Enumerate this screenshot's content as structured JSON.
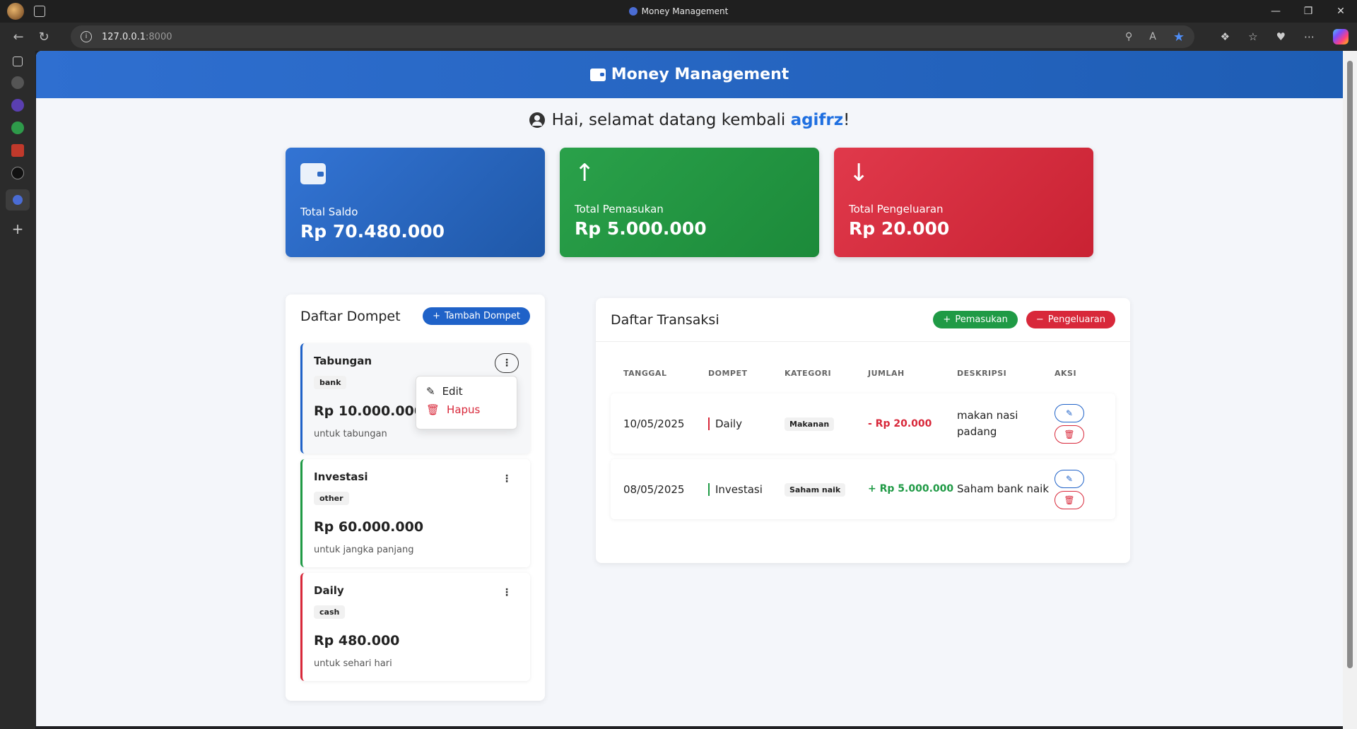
{
  "browser": {
    "tab_title": "Money Management",
    "url_host": "127.0.0.1",
    "url_port": ":8000"
  },
  "app": {
    "title": "Money Management",
    "welcome_prefix": "Hai, selamat datang kembali ",
    "username": "agifrz",
    "welcome_suffix": "!"
  },
  "stats": {
    "saldo": {
      "label": "Total Saldo",
      "value": "Rp 70.480.000",
      "icon": "wallet-icon",
      "color": "#2a66c6"
    },
    "pemasukan": {
      "label": "Total Pemasukan",
      "value": "Rp 5.000.000",
      "icon": "arrow-up-icon",
      "color": "#24963f"
    },
    "pengeluaran": {
      "label": "Total Pengeluaran",
      "value": "Rp 20.000",
      "icon": "arrow-down-icon",
      "color": "#d8283a"
    }
  },
  "wallets": {
    "title": "Daftar Dompet",
    "add_label": "Tambah Dompet",
    "menu": {
      "edit": "Edit",
      "delete": "Hapus"
    },
    "items": [
      {
        "name": "Tabungan",
        "type": "bank",
        "balance": "Rp 10.000.000",
        "desc": "untuk tabungan"
      },
      {
        "name": "Investasi",
        "type": "other",
        "balance": "Rp 60.000.000",
        "desc": "untuk jangka panjang"
      },
      {
        "name": "Daily",
        "type": "cash",
        "balance": "Rp 480.000",
        "desc": "untuk sehari hari"
      }
    ]
  },
  "transactions": {
    "title": "Daftar Transaksi",
    "income_label": "Pemasukan",
    "expense_label": "Pengeluaran",
    "columns": [
      "TANGGAL",
      "DOMPET",
      "KATEGORI",
      "JUMLAH",
      "DESKRIPSI",
      "AKSI"
    ],
    "rows": [
      {
        "date": "10/05/2025",
        "wallet": "Daily",
        "category": "Makanan",
        "amount": "- Rp 20.000",
        "desc": "makan nasi padang"
      },
      {
        "date": "08/05/2025",
        "wallet": "Investasi",
        "category": "Saham naik",
        "amount": "+ Rp 5.000.000",
        "desc": "Saham bank naik"
      }
    ]
  }
}
